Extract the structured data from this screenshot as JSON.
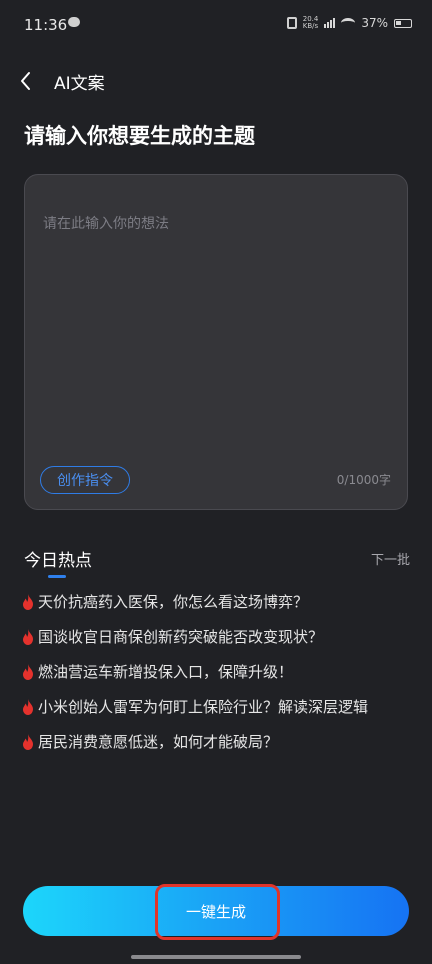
{
  "status_bar": {
    "time": "11:36",
    "speed_top": "20.4",
    "speed_bottom": "KB/s",
    "battery": "37%"
  },
  "topbar": {
    "back_icon": "chevron-left-icon",
    "title": "AI文案"
  },
  "page_title": "请输入你想要生成的主题",
  "input": {
    "placeholder": "请在此输入你的想法",
    "value": "",
    "command_button": "创作指令",
    "char_count": "0/1000字"
  },
  "hot": {
    "title": "今日热点",
    "next_label": "下一批",
    "icon": "fire-icon",
    "items": [
      "天价抗癌药入医保，你怎么看这场博弈？",
      "国谈收官日商保创新药突破能否改变现状？",
      "燃油营运车新增投保入口，保障升级！",
      "小米创始人雷军为何盯上保险行业？解读深层逻辑",
      "居民消费意愿低迷，如何才能破局？"
    ]
  },
  "generate_button": "一键生成",
  "colors": {
    "background": "#202125",
    "accent": "#2f80ed",
    "gradient_start": "#1cd6fb",
    "gradient_end": "#1673f3",
    "fire": "#e5322d",
    "highlight": "#e0342a"
  }
}
